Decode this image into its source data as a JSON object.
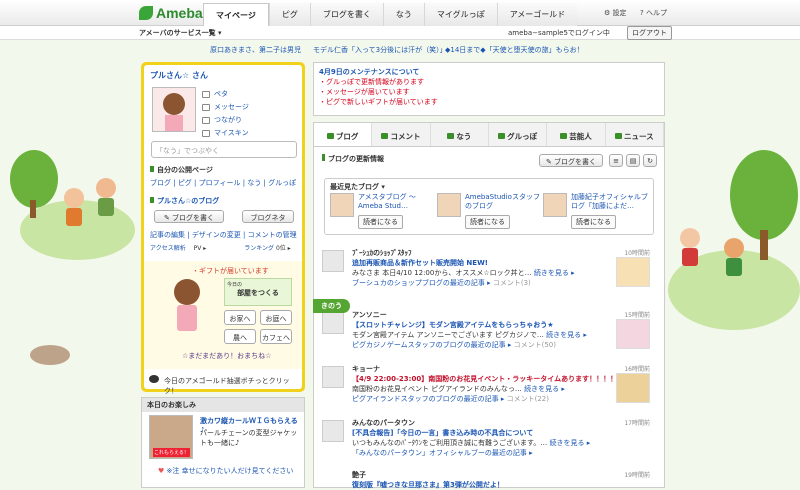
{
  "header": {
    "logo": "Ameba",
    "tabs": [
      "マイページ",
      "ピグ",
      "ブログを書く",
      "なう",
      "マイグルっぽ",
      "アメーゴールド"
    ],
    "settings": "設定",
    "help": "ヘルプ"
  },
  "subbar": {
    "services": "アメーバのサービス一覧 ▾",
    "login_text": "ameba−sample5でログイン中",
    "logout": "ログアウト"
  },
  "ticker": [
    "原口あきまさ、第二子は男児",
    "モデル仁香「入って3分後には汗が（笑）」",
    "◆14日まで◆「天使と堕天使の旅」もらお！"
  ],
  "profile": {
    "name": "プルさん☆ さん",
    "links": [
      "ペタ",
      "メッセージ",
      "つながり",
      "マイスキン"
    ],
    "status_placeholder": "「なう」でつぶやく"
  },
  "public_pages": {
    "title": "自分の公開ページ",
    "links": [
      "ブログ",
      "ピグ",
      "プロフィール",
      "なう",
      "グルっぽ"
    ]
  },
  "blog": {
    "title": "プルさん☆のブログ",
    "write": "ブログを書く",
    "neta": "ブログネタ",
    "links": [
      "記事の編集",
      "デザインの変更",
      "コメントの管理"
    ],
    "access": "アクセス解析",
    "pv": "PV ▸",
    "rank": "ランキング",
    "rank_val": "0位 ▸"
  },
  "gift": {
    "title": "・ギフトが届いています",
    "room_label": "部屋をつくる",
    "room_sub": "今日の",
    "buttons": [
      "お家へ",
      "お庭へ",
      "農へ",
      "カフェへ"
    ],
    "bottom": "☆まだまだあり！おまちね☆"
  },
  "gold": "今日のアメゴールド抽選ボチっとクリック！",
  "fun": {
    "title": "本日のお楽しみ",
    "img_label": "これもらえる！",
    "headline": "激カワ縦カールＷＩＧもらえる♪",
    "desc": "パールチェーンの変型ジャケットも一緒に♪",
    "footer": "※注 幸せになりたい人だけ見てください"
  },
  "notice": {
    "title": "4月9日のメンテナンスについて",
    "items": [
      "・グルっぽで更新情報があります",
      "・メッセージが届いています",
      "・ピグで新しいギフトが届いています"
    ]
  },
  "main": {
    "tabs": [
      "ブログ",
      "コメント",
      "なう",
      "グルっぽ",
      "芸能人",
      "ニュース"
    ],
    "update_title": "ブログの更新情報",
    "write_btn": "ブログを書く",
    "recent_title": "最近見たブログ ▾",
    "recent": [
      {
        "name": "アメスタブログ 〜Ameba Stud…",
        "read": "読者になる"
      },
      {
        "name": "AmebaStudioスタッフのブログ",
        "read": "読者になる"
      },
      {
        "name": "加藤紀子オフィシャルブログ「加藤によだ…",
        "read": "読者になる"
      }
    ],
    "kinou": "きのう",
    "feed": [
      {
        "who": "ﾌﾞｰｼｭｶのｼｮｯﾌﾟｽﾀｯﾌ",
        "title": "追加再販商品＆新作セット販売開始 NEW!",
        "body": "みなさま 本日4/10 12:00から、オススメ☆ロック丼と…",
        "more": "続きを見る ▸",
        "link": "ブーシュカのショップブログの最近の記事 ▸",
        "comment": "コメント(3)",
        "time": "10時間前"
      },
      {
        "who": "アンソニー",
        "title": "【スロットチャレンジ】モダン宮殿アイテムをもらっちゃおう★",
        "body": "モダン宮殿アイテム アンソニーでございます ピグカジノで…",
        "more": "続きを見る ▸",
        "link": "ピグカジノゲームスタッフのブログの最近の記事 ▸",
        "comment": "コメント(50)",
        "time": "15時間前"
      },
      {
        "who": "キョーナ",
        "title": "【4/9 22:00-23:00】南国粉のお花見イベント・ラッキータイムあります！！！！！",
        "body": "南国粉のお花見イベント ピグアイランドのみんなっ…",
        "more": "続きを見る ▸",
        "link": "ピグアイランドスタッフのブログの最近の記事 ▸",
        "comment": "コメント(22)",
        "time": "16時間前"
      },
      {
        "who": "みんなのパータウン",
        "title": "[不具合報告]「今日の一言」書き込み時の不具合について",
        "body": "いつもみんなのﾊﾟｰﾀｳﾝをご利用頂き誠に有難うございます。…",
        "more": "続きを見る ▸",
        "link": "「みんなのパータウン」オフィシャルブーの最近の記事 ▸",
        "comment": "",
        "time": "17時間前"
      },
      {
        "who": "艶子",
        "title": "復刻版『嘘つきな旦那さま』第3弾が公開だよ！",
        "body": "",
        "more": "",
        "link": "",
        "comment": "",
        "time": "19時間前"
      }
    ]
  }
}
